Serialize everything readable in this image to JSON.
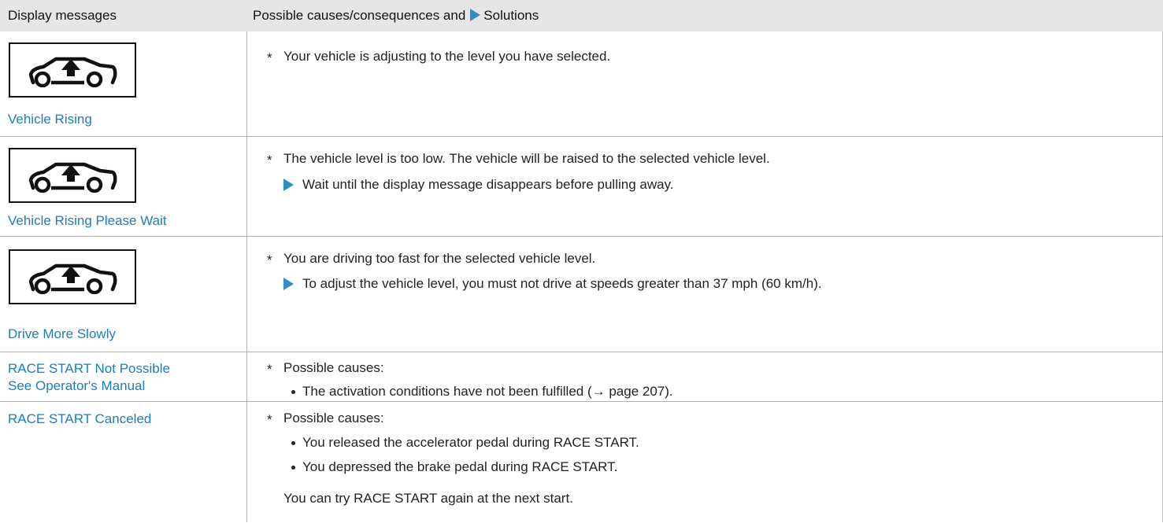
{
  "header": {
    "col1": "Display messages",
    "col2_before": "Possible causes/consequences and",
    "col2_after": "Solutions"
  },
  "rows": [
    {
      "icon": "vehicle-rising-icon",
      "message": "Vehicle Rising",
      "cause": "Your vehicle is adjusting to the level you have selected."
    },
    {
      "icon": "vehicle-rising-icon",
      "message": "Vehicle Rising Please Wait",
      "cause": "The vehicle level is too low. The vehicle will be raised to the selected vehicle level.",
      "solution": "Wait until the display message disappears before pulling away."
    },
    {
      "icon": "vehicle-rising-icon",
      "message": "Drive More Slowly",
      "cause": "You are driving too fast for the selected vehicle level.",
      "solution": "To adjust the vehicle level, you must not drive at speeds greater than 37 mph (60 km/h)."
    },
    {
      "message_line1": "RACE START Not Possible",
      "message_line2": "See Operator's Manual",
      "cause": "Possible causes:",
      "bullets": [
        "The activation conditions have not been fulfilled (→ page 207)."
      ]
    },
    {
      "message": "RACE START Canceled",
      "cause": "Possible causes:",
      "bullets": [
        "You released the accelerator pedal during RACE START.",
        "You depressed the brake pedal during RACE START."
      ],
      "note": "You can try RACE START again at the next start."
    }
  ],
  "asterisk": "*",
  "colors": {
    "link": "#1d7db8",
    "solution_arrow": "#2f8fc4",
    "header_bg": "#e6e6e6"
  }
}
